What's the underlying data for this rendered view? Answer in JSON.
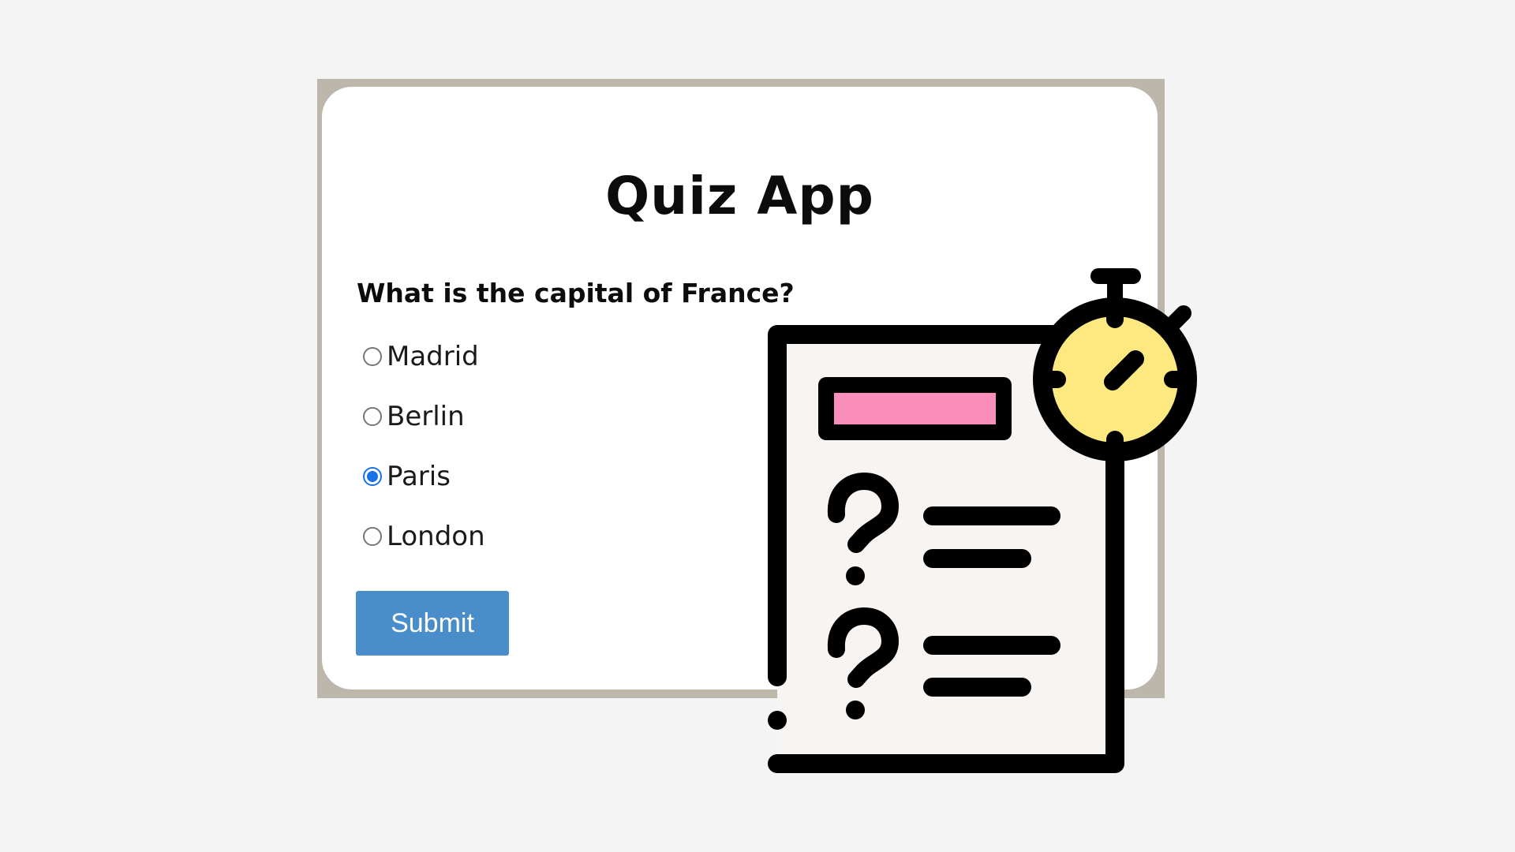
{
  "quiz": {
    "title": "Quiz App",
    "question": "What is the capital of France?",
    "options": [
      {
        "label": "Madrid",
        "selected": false
      },
      {
        "label": "Berlin",
        "selected": false
      },
      {
        "label": "Paris",
        "selected": true
      },
      {
        "label": "London",
        "selected": false
      }
    ],
    "submit_label": "Submit"
  },
  "illustration": {
    "icon": "quiz-timer-icon",
    "colors": {
      "outline": "#000000",
      "paper": "#f7f4f1",
      "header_bar": "#f98ebb",
      "stopwatch_face": "#fde97f"
    }
  },
  "colors": {
    "page_background": "#f4f4f4",
    "frame": "#bcb6ab",
    "card": "#ffffff",
    "submit_button": "#4a8dcb",
    "radio_selected": "#1a73e8"
  }
}
